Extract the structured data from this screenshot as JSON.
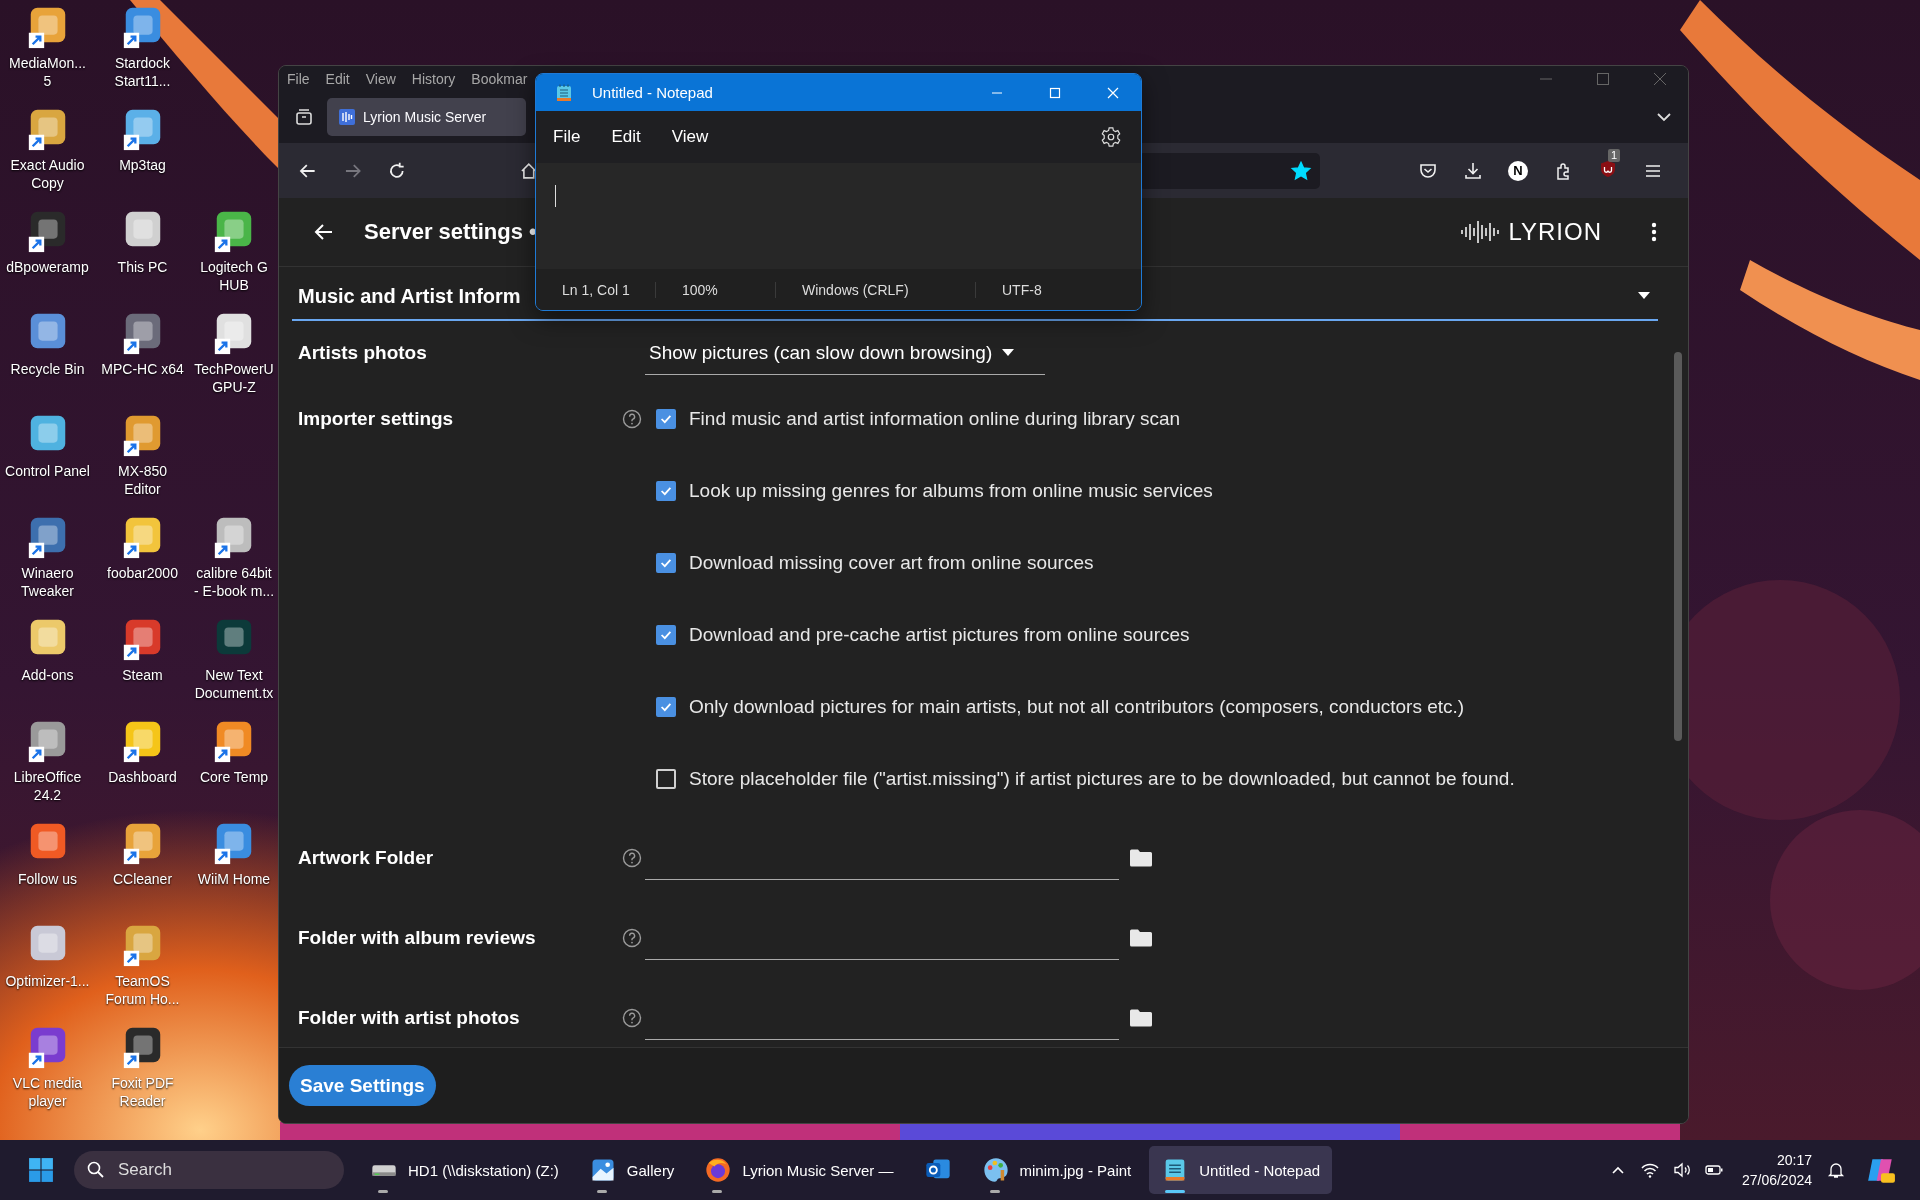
{
  "desktop": {
    "rows": [
      {
        "icons": [
          {
            "label": "MediaMon...\n5",
            "shortcut": true
          },
          {
            "label": "Stardock\nStart11...",
            "shortcut": true
          }
        ]
      },
      {
        "icons": [
          {
            "label": "Exact Audio\nCopy",
            "shortcut": true
          },
          {
            "label": "Mp3tag",
            "shortcut": true
          }
        ]
      },
      {
        "icons": [
          {
            "label": "dBpoweramp",
            "shortcut": true
          },
          {
            "label": "This PC",
            "shortcut": false
          },
          {
            "label": "Logitech G\nHUB",
            "shortcut": true
          }
        ]
      },
      {
        "icons": [
          {
            "label": "Recycle Bin",
            "shortcut": false
          },
          {
            "label": "MPC-HC x64",
            "shortcut": true
          },
          {
            "label": "TechPowerU\nGPU-Z",
            "shortcut": true
          }
        ]
      },
      {
        "icons": [
          {
            "label": "Control Panel",
            "shortcut": false
          },
          {
            "label": "MX-850\nEditor",
            "shortcut": true
          }
        ]
      },
      {
        "icons": [
          {
            "label": "Winaero\nTweaker",
            "shortcut": true
          },
          {
            "label": "foobar2000",
            "shortcut": true
          },
          {
            "label": "calibre 64bit\n- E-book m...",
            "shortcut": true
          }
        ]
      },
      {
        "icons": [
          {
            "label": "Add-ons",
            "shortcut": false
          },
          {
            "label": "Steam",
            "shortcut": true
          },
          {
            "label": "New Text\nDocument.tx",
            "shortcut": false
          }
        ]
      },
      {
        "icons": [
          {
            "label": "LibreOffice\n24.2",
            "shortcut": true
          },
          {
            "label": "Dashboard",
            "shortcut": true
          },
          {
            "label": "Core Temp",
            "shortcut": true
          }
        ]
      },
      {
        "icons": [
          {
            "label": "Follow us",
            "shortcut": false
          },
          {
            "label": "CCleaner",
            "shortcut": true
          },
          {
            "label": "WiiM Home",
            "shortcut": true
          }
        ]
      },
      {
        "icons": [
          {
            "label": "Optimizer-1...",
            "shortcut": false
          },
          {
            "label": "TeamOS\nForum Ho...",
            "shortcut": true
          }
        ]
      },
      {
        "icons": [
          {
            "label": "VLC media\nplayer",
            "shortcut": true
          },
          {
            "label": "Foxit PDF\nReader",
            "shortcut": true
          }
        ]
      }
    ]
  },
  "browser": {
    "menu": [
      "File",
      "Edit",
      "View",
      "History",
      "Bookmar"
    ],
    "tab": {
      "title": "Lyrion Music Server",
      "selected": true
    },
    "nav": [
      {
        "kind": "back",
        "disabled": false
      },
      {
        "kind": "forward",
        "disabled": true
      },
      {
        "kind": "reload",
        "disabled": false
      }
    ],
    "bookmarked": true,
    "profile_initial": "N",
    "extension_badge": "1",
    "page": {
      "title": "Server settings •",
      "logo": "LYRION",
      "section": "Music and Artist Inform",
      "settings": [
        {
          "kind": "select",
          "label": "Artists photos",
          "help": false,
          "value": "Show pictures (can slow down browsing)"
        },
        {
          "kind": "checkboxes",
          "label": "Importer settings",
          "help": true,
          "options": [
            {
              "text": "Find music and artist information online during library scan",
              "checked": true
            },
            {
              "text": "Look up missing genres for albums from online music services",
              "checked": true
            },
            {
              "text": "Download missing cover art from online sources",
              "checked": true
            },
            {
              "text": "Download and pre-cache artist pictures from online sources",
              "checked": true
            },
            {
              "text": "Only download pictures for main artists, but not all contributors (composers, conductors etc.)",
              "checked": true
            },
            {
              "text": "Store placeholder file (\"artist.missing\") if artist pictures are to be downloaded, but cannot be found.",
              "checked": false
            }
          ]
        },
        {
          "kind": "folder",
          "label": "Artwork Folder",
          "help": true
        },
        {
          "kind": "folder",
          "label": "Folder with album reviews",
          "help": true
        },
        {
          "kind": "folder",
          "label": "Folder with artist photos",
          "help": true
        }
      ],
      "save_button": "Save Settings"
    }
  },
  "notepad": {
    "title": "Untitled - Notepad",
    "menu": [
      "File",
      "Edit",
      "View"
    ],
    "status": [
      "Ln 1, Col 1",
      "100%",
      "Windows (CRLF)",
      "UTF-8"
    ]
  },
  "taskbar": {
    "search_placeholder": "Search",
    "apps": [
      {
        "kind": "drive",
        "label": "HD1 (\\\\diskstation) (Z:)",
        "running": true,
        "active": false
      },
      {
        "kind": "gallery",
        "label": "Gallery",
        "running": true,
        "active": false
      },
      {
        "kind": "firefox",
        "label": "Lyrion Music Server —",
        "running": true,
        "active": false
      },
      {
        "kind": "outlook",
        "running": false,
        "active": false
      },
      {
        "kind": "paint",
        "label": "minim.jpg - Paint",
        "running": true,
        "active": false
      },
      {
        "kind": "notepad",
        "label": "Untitled - Notepad",
        "running": true,
        "active": true
      }
    ],
    "time": "20:17",
    "date": "27/06/2024"
  }
}
